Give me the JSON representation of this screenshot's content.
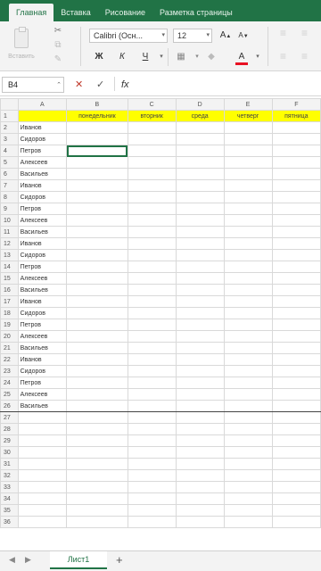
{
  "ribbon_tabs": [
    "Главная",
    "Вставка",
    "Рисование",
    "Разметка страницы"
  ],
  "ribbon": {
    "paste_label": "Вставить",
    "font_name": "Calibri (Осн...",
    "font_size": "12",
    "grow_font": "A",
    "shrink_font": "A",
    "bold": "Ж",
    "italic": "К",
    "underline": "Ч",
    "font_color": "A"
  },
  "formula_bar": {
    "name_box": "B4",
    "cancel": "✕",
    "confirm": "✓",
    "fx": "fx",
    "formula": ""
  },
  "grid": {
    "columns": [
      "A",
      "B",
      "C",
      "D",
      "E",
      "F"
    ],
    "header_row": [
      "",
      "понедельник",
      "вторник",
      "среда",
      "четверг",
      "пятница"
    ],
    "names": [
      "Иванов",
      "Сидоров",
      "Петров",
      "Алексеев",
      "Васильев",
      "Иванов",
      "Сидоров",
      "Петров",
      "Алексеев",
      "Васильев",
      "Иванов",
      "Сидоров",
      "Петров",
      "Алексеев",
      "Васильев",
      "Иванов",
      "Сидоров",
      "Петров",
      "Алексеев",
      "Васильев",
      "Иванов",
      "Сидоров",
      "Петров",
      "Алексеев",
      "Васильев"
    ],
    "empty_rows": [
      27,
      28,
      29,
      30,
      31,
      32,
      33,
      34,
      35,
      36
    ],
    "selected_cell": "B4"
  },
  "sheet_tabs": {
    "active": "Лист1",
    "add": "+"
  }
}
